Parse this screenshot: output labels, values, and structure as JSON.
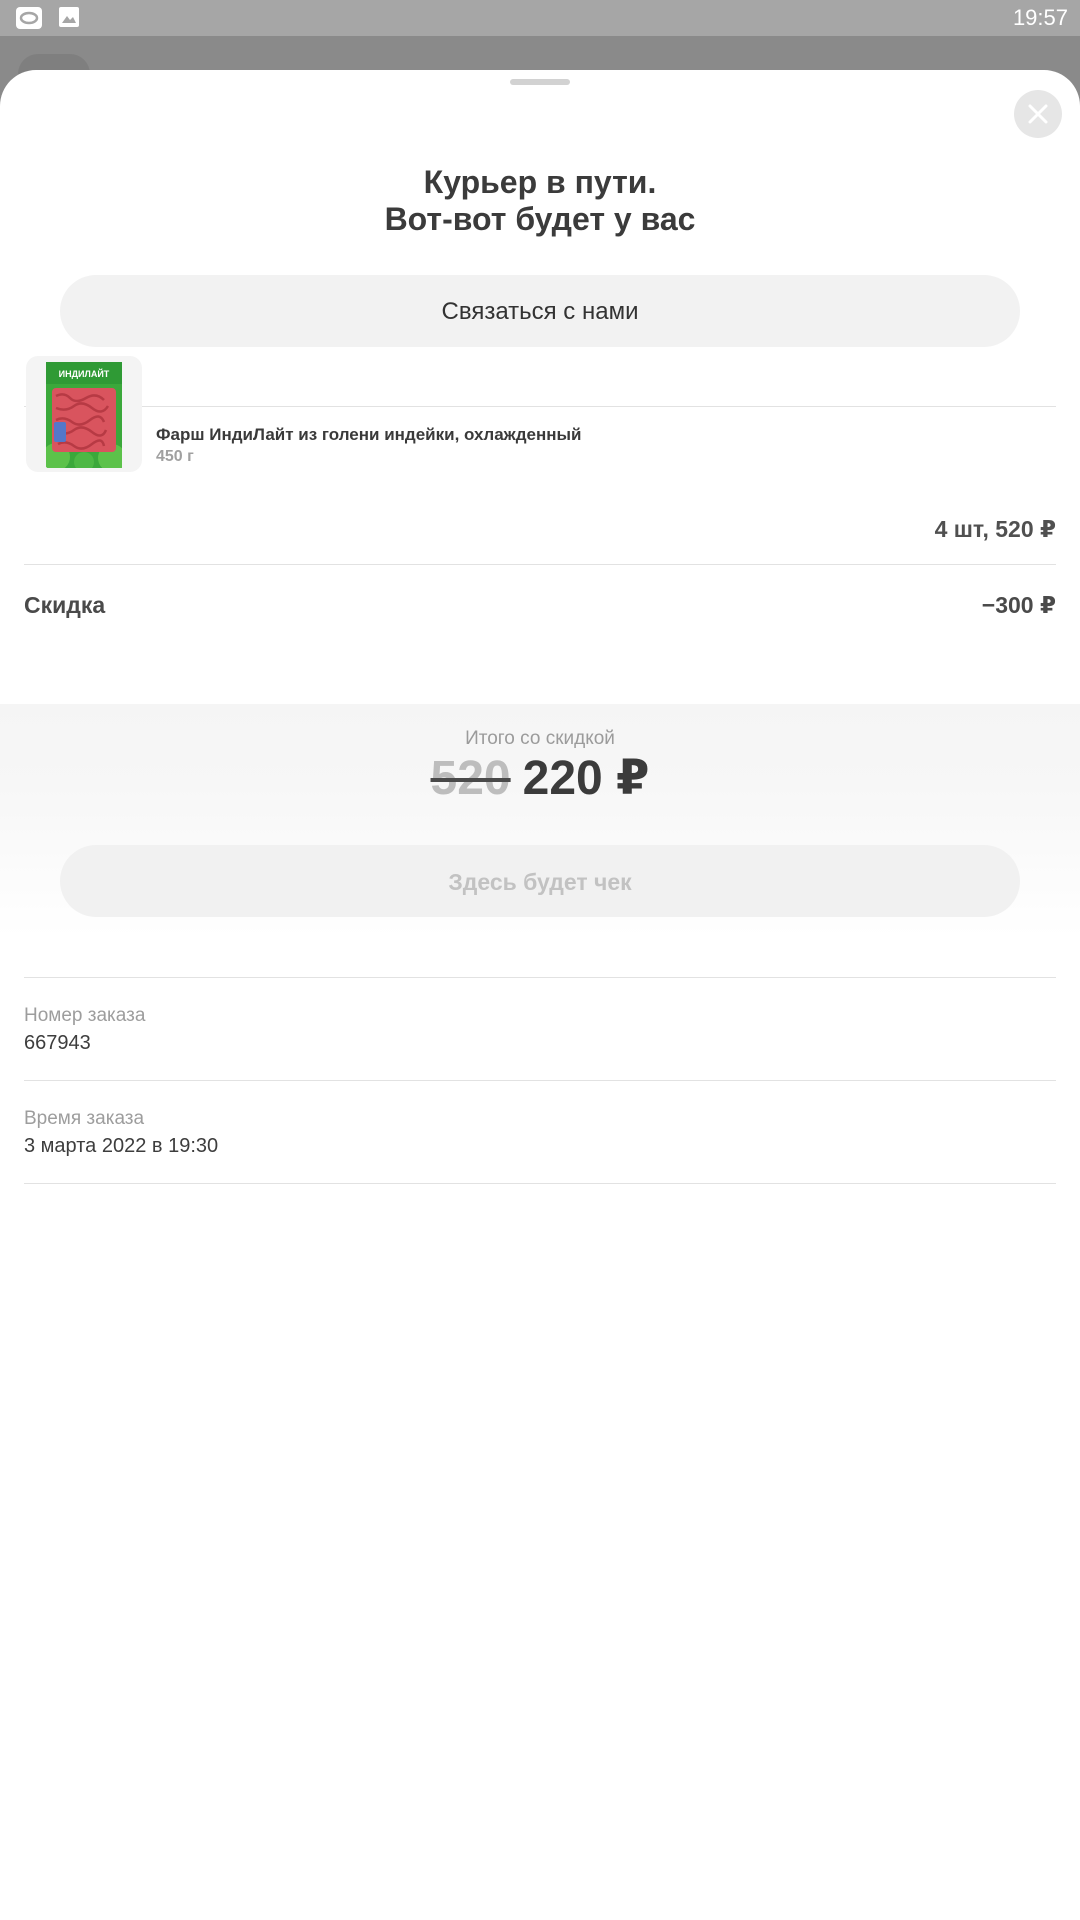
{
  "status_bar": {
    "time": "19:57",
    "icons": [
      "notification-icon",
      "image-icon"
    ]
  },
  "order_sheet": {
    "title_line1": "Курьер в пути.",
    "title_line2": "Вот-вот будет у вас",
    "contact_button": "Связаться с нами",
    "close_icon": "close-icon",
    "items": [
      {
        "name": "Фарш ИндиЛайт из голени индейки, охлажденный",
        "weight": "450 г",
        "quantity_price": "4 шт, 520 ₽",
        "image_brand_text": "ИНДИЛАЙТ"
      }
    ],
    "discount": {
      "label": "Скидка",
      "value": "−300 ₽"
    },
    "total": {
      "label": "Итого со скидкой",
      "old_price": "520",
      "new_price": "220 ₽"
    },
    "receipt_button": "Здесь будет чек",
    "order_number": {
      "label": "Номер заказа",
      "value": "667943"
    },
    "order_time": {
      "label": "Время заказа",
      "value": "3 марта 2022 в 19:30"
    }
  },
  "colors": {
    "overlay": "#8a8a8a",
    "status_bar": "#a6a6a6",
    "text_primary": "#3b3b3b",
    "text_secondary": "#9d9d9d",
    "button_bg": "#f2f2f2"
  }
}
